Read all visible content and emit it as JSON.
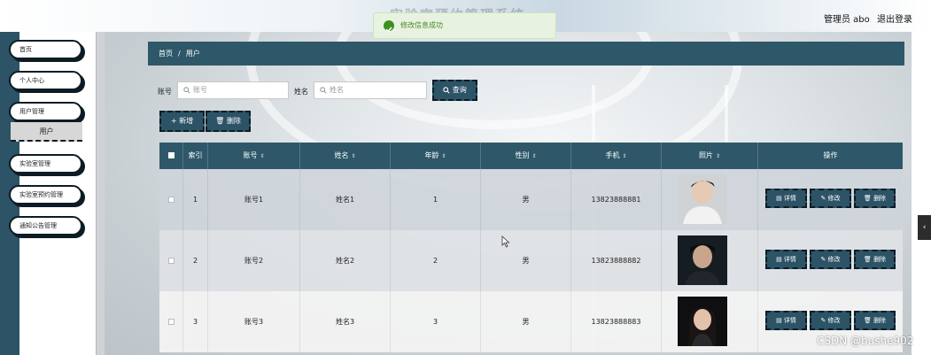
{
  "header": {
    "title": "实验室预约管理系统",
    "admin_label": "管理员 abo",
    "logout_label": "退出登录"
  },
  "toast": {
    "message": "修改信息成功"
  },
  "sidebar": {
    "items": [
      {
        "label": "首页"
      },
      {
        "label": "个人中心"
      },
      {
        "label": "用户管理"
      },
      {
        "label": "实验室管理"
      },
      {
        "label": "实验室预约管理"
      },
      {
        "label": "通知公告管理"
      }
    ],
    "active_sub": "用户"
  },
  "breadcrumb": {
    "home": "首页",
    "sep": "/",
    "current": "用户"
  },
  "search": {
    "account_label": "账号",
    "account_placeholder": "账号",
    "name_label": "姓名",
    "name_placeholder": "姓名",
    "query_button": "查询"
  },
  "toolbar": {
    "add": "新增",
    "delete": "删除"
  },
  "table": {
    "headers": [
      "索引",
      "账号",
      "姓名",
      "年龄",
      "性别",
      "手机",
      "照片",
      "操作"
    ],
    "rows": [
      {
        "index": "1",
        "account": "账号1",
        "name": "姓名1",
        "age": "1",
        "gender": "男",
        "phone": "13823888881"
      },
      {
        "index": "2",
        "account": "账号2",
        "name": "姓名2",
        "age": "2",
        "gender": "男",
        "phone": "13823888882"
      },
      {
        "index": "3",
        "account": "账号3",
        "name": "姓名3",
        "age": "3",
        "gender": "男",
        "phone": "13823888883"
      }
    ],
    "actions": {
      "detail": "详情",
      "edit": "修改",
      "delete": "删除"
    }
  },
  "watermark": "CSDN @bushe902",
  "colors": {
    "primary": "#2e5869",
    "sidebar_stripe": "#2c5366",
    "toast_bg": "#e7f2e0",
    "toast_text": "#4a8a2a"
  }
}
